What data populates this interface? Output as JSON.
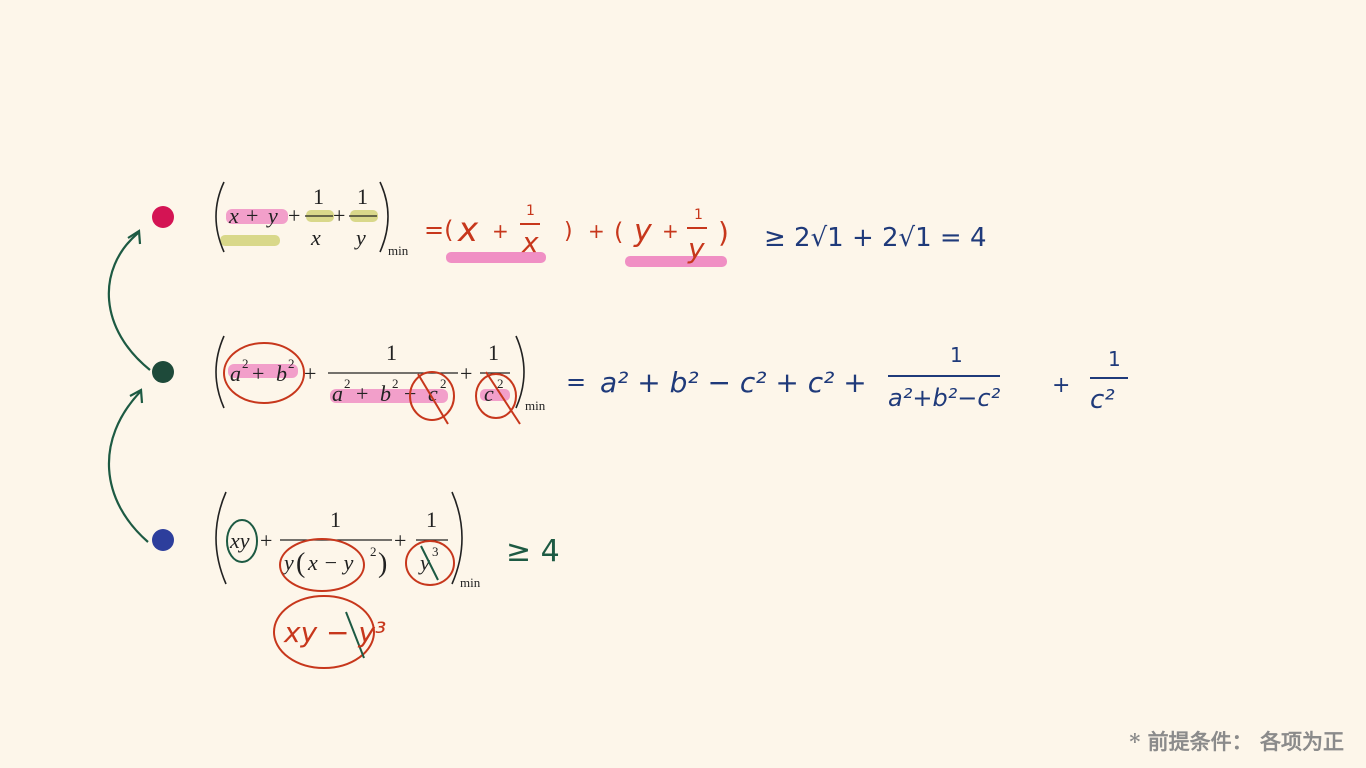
{
  "colors": {
    "background": "#fdf6ea",
    "bullet_red": "#d41454",
    "bullet_green": "#1e4a3a",
    "bullet_blue": "#2d3e9c",
    "ink_red": "#c7371c",
    "ink_navy": "#1f3a7a",
    "ink_green": "#1d5a43",
    "highlight_pink": "#f08fc4",
    "highlight_olive": "#d9d88a"
  },
  "row1": {
    "vars": [
      "x",
      "y"
    ],
    "one": "1",
    "plus": "+",
    "sub": "min",
    "hand_eq": "=(",
    "hand_x": "x",
    "hand_plus": "+",
    "hand_one": "1",
    "hand_close": ")",
    "hand_y": "y",
    "hand_rhs": "≥ 2√1 + 2√1 = 4"
  },
  "row2": {
    "a": "a",
    "b": "b",
    "c": "c",
    "sq": "2",
    "one": "1",
    "plus": "+",
    "minus": "−",
    "sub": "min",
    "hand_eq": "=",
    "hand_expr": "a² + b² − c² + c² +",
    "hand_one": "1",
    "hand_den1": "a²+b²−c²",
    "hand_plus": "+",
    "hand_den2": "c²"
  },
  "row3": {
    "xy": "xy",
    "one": "1",
    "plus": "+",
    "den1_y": "y",
    "den1_inner": "x − y",
    "sq": "2",
    "den2": "y",
    "cube": "3",
    "sub": "min",
    "hand_rhs": "≥ 4",
    "hand_below": "xy − y³"
  },
  "footnote": "* 前提条件： 各项为正"
}
